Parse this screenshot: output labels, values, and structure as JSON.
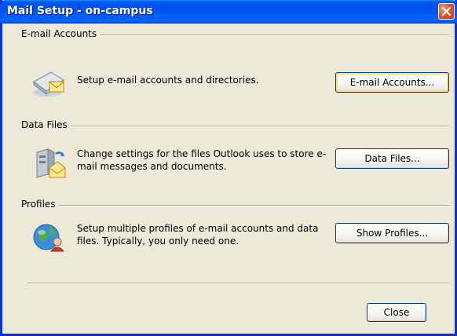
{
  "window": {
    "title": "Mail Setup - on-campus"
  },
  "sections": [
    {
      "heading": "E-mail Accounts",
      "description": "Setup e-mail accounts and directories.",
      "button": "E-mail Accounts...",
      "icon": "mail-accounts-icon"
    },
    {
      "heading": "Data Files",
      "description": "Change settings for the files Outlook uses to store e-mail messages and documents.",
      "button": "Data Files...",
      "icon": "data-files-icon"
    },
    {
      "heading": "Profiles",
      "description": "Setup multiple profiles of e-mail accounts and data files. Typically, you only need one.",
      "button": "Show Profiles...",
      "icon": "profiles-icon"
    }
  ],
  "footer": {
    "close_label": "Close"
  },
  "colors": {
    "titlebar": "#0054e3",
    "window_bg": "#ece9d8",
    "close_button": "#e0502a"
  }
}
